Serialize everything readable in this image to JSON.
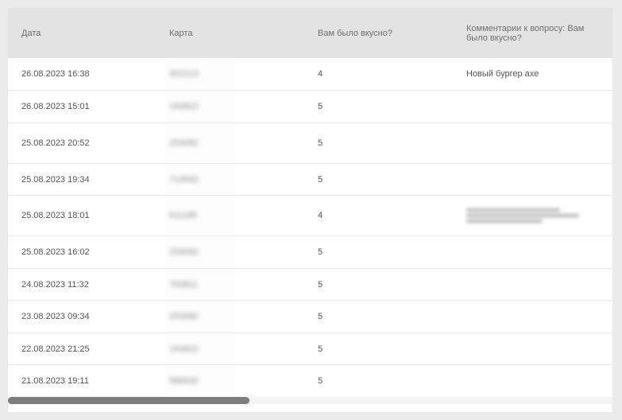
{
  "table": {
    "headers": {
      "date": "Дата",
      "card": "Карта",
      "tasty": "Вам было вкусно?",
      "comment": "Комментарии к вопросу: Вам было вкусно?"
    },
    "rows": [
      {
        "date": "26.08.2023 16:38",
        "card": "302213",
        "tasty": "4",
        "comment": "Новый бургер ахе"
      },
      {
        "date": "26.08.2023 15:01",
        "card": "150822",
        "tasty": "5",
        "comment": ""
      },
      {
        "date": "25.08.2023 20:52",
        "card": "253082",
        "tasty": "5",
        "comment": ""
      },
      {
        "date": "25.08.2023 19:34",
        "card": "713592",
        "tasty": "5",
        "comment": ""
      },
      {
        "date": "25.08.2023 18:01",
        "card": "611185",
        "tasty": "4",
        "comment": ""
      },
      {
        "date": "25.08.2023 16:02",
        "card": "253082",
        "tasty": "5",
        "comment": ""
      },
      {
        "date": "24.08.2023 11:32",
        "card": "700811",
        "tasty": "5",
        "comment": ""
      },
      {
        "date": "23.08.2023 09:34",
        "card": "253082",
        "tasty": "5",
        "comment": ""
      },
      {
        "date": "22.08.2023 21:25",
        "card": "150822",
        "tasty": "5",
        "comment": ""
      },
      {
        "date": "21.08.2023 19:11",
        "card": "588932",
        "tasty": "5",
        "comment": ""
      }
    ]
  },
  "scroll": {
    "horizontal_position_fraction": 0.0,
    "visible_fraction": 0.4
  }
}
